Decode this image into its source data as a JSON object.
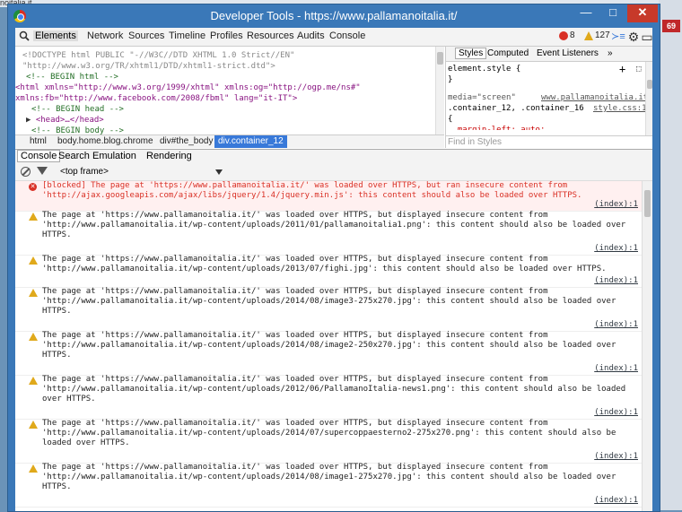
{
  "background": {
    "tab_fragment": "noitalia.it",
    "badge": "69"
  },
  "window": {
    "title": "Developer Tools - https://www.pallamanoitalia.it/",
    "min": "—",
    "max": "□",
    "close": "✕"
  },
  "toolbar": {
    "tabs": [
      "Elements",
      "Network",
      "Sources",
      "Timeline",
      "Profiles",
      "Resources",
      "Audits",
      "Console"
    ],
    "errors": "8",
    "warnings": "127",
    "icons": {
      "drawer": "≻≡",
      "settings": "⚙",
      "dock": "▭"
    }
  },
  "elements": {
    "lines": [
      "<!DOCTYPE html PUBLIC \"-//W3C//DTD XHTML 1.0 Strict//EN\"",
      "\"http://www.w3.org/TR/xhtml1/DTD/xhtml1-strict.dtd\">",
      "<!-- BEGIN html -->",
      "<html xmlns=\"http://www.w3.org/1999/xhtml\" xmlns:og=\"http://ogp.me/ns#\"",
      "xmlns:fb=\"http://www.facebook.com/2008/fbml\" lang=\"it-IT\">",
      "<!-- BEGIN head -->",
      "<head>…</head>",
      "<!-- BEGIN body -->"
    ]
  },
  "breadcrumbs": [
    "html",
    "body.home.blog.chrome",
    "div#the_body",
    "div.container_12"
  ],
  "styles": {
    "tabs": [
      "Styles",
      "Computed",
      "Event Listeners"
    ],
    "more": "»",
    "lines": [
      "element.style {",
      "}",
      "media=\"screen\"",
      ".container_12, .container_16",
      "{",
      "  margin-left: auto;"
    ],
    "source_site": "www.pallamanoitalia.it/",
    "source_file": "style.css:13",
    "find_placeholder": "Find in Styles"
  },
  "drawer": {
    "tabs": [
      "Console",
      "Search",
      "Emulation",
      "Rendering"
    ],
    "frame": "<top frame>"
  },
  "console": {
    "messages": [
      {
        "level": "error",
        "lines": [
          "[blocked] The page at 'https://www.pallamanoitalia.it/' was loaded over HTTPS, but ran insecure content from",
          "'http://ajax.googleapis.com/ajax/libs/jquery/1.4/jquery.min.js': this content should also be loaded over HTTPS."
        ],
        "source": "(index):1"
      },
      {
        "level": "warning",
        "lines": [
          "The page at 'https://www.pallamanoitalia.it/' was loaded over HTTPS, but displayed insecure content from",
          "'http://www.pallamanoitalia.it/wp-content/uploads/2011/01/pallamanoitalia1.png': this content should also be loaded over",
          "HTTPS."
        ],
        "source": "(index):1"
      },
      {
        "level": "warning",
        "lines": [
          "The page at 'https://www.pallamanoitalia.it/' was loaded over HTTPS, but displayed insecure content from",
          "'http://www.pallamanoitalia.it/wp-content/uploads/2013/07/fighi.jpg': this content should also be loaded over HTTPS."
        ],
        "source": "(index):1"
      },
      {
        "level": "warning",
        "lines": [
          "The page at 'https://www.pallamanoitalia.it/' was loaded over HTTPS, but displayed insecure content from",
          "'http://www.pallamanoitalia.it/wp-content/uploads/2014/08/image3-275x270.jpg': this content should also be loaded over",
          "HTTPS."
        ],
        "source": "(index):1"
      },
      {
        "level": "warning",
        "lines": [
          "The page at 'https://www.pallamanoitalia.it/' was loaded over HTTPS, but displayed insecure content from",
          "'http://www.pallamanoitalia.it/wp-content/uploads/2014/08/image2-250x270.jpg': this content should also be loaded over",
          "HTTPS."
        ],
        "source": "(index):1"
      },
      {
        "level": "warning",
        "lines": [
          "The page at 'https://www.pallamanoitalia.it/' was loaded over HTTPS, but displayed insecure content from",
          "'http://www.pallamanoitalia.it/wp-content/uploads/2012/06/PallamanoItalia-news1.png': this content should also be loaded",
          "over HTTPS."
        ],
        "source": "(index):1"
      },
      {
        "level": "warning",
        "lines": [
          "The page at 'https://www.pallamanoitalia.it/' was loaded over HTTPS, but displayed insecure content from",
          "'http://www.pallamanoitalia.it/wp-content/uploads/2014/07/supercoppaesterno2-275x270.png': this content should also be",
          "loaded over HTTPS."
        ],
        "source": "(index):1"
      },
      {
        "level": "warning",
        "lines": [
          "The page at 'https://www.pallamanoitalia.it/' was loaded over HTTPS, but displayed insecure content from",
          "'http://www.pallamanoitalia.it/wp-content/uploads/2014/08/image1-275x270.jpg': this content should also be loaded over",
          "HTTPS."
        ],
        "source": "(index):1"
      }
    ]
  },
  "colors": {
    "error": "#d93025",
    "warning": "#e0a91b",
    "selection": "#3879d9",
    "titlebar": "#3a78b8"
  }
}
